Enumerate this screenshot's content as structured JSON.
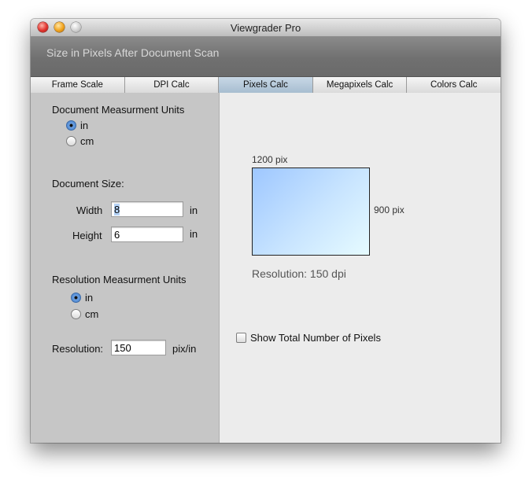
{
  "window": {
    "title": "Viewgrader Pro"
  },
  "header": {
    "subtitle": "Size in Pixels After Document Scan"
  },
  "tabs": [
    {
      "label": "Frame Scale",
      "active": false
    },
    {
      "label": "DPI Calc",
      "active": false
    },
    {
      "label": "Pixels Calc",
      "active": true
    },
    {
      "label": "Megapixels Calc",
      "active": false
    },
    {
      "label": "Colors Calc",
      "active": false
    }
  ],
  "left": {
    "doc_units": {
      "heading": "Document Measurment Units",
      "options": [
        {
          "label": "in",
          "selected": true
        },
        {
          "label": "cm",
          "selected": false
        }
      ]
    },
    "doc_size": {
      "heading": "Document Size:",
      "width_label": "Width",
      "width_value": "8",
      "width_unit": "in",
      "height_label": "Height",
      "height_value": "6",
      "height_unit": "in"
    },
    "res_units": {
      "heading": "Resolution Measurment Units",
      "options": [
        {
          "label": "in",
          "selected": true
        },
        {
          "label": "cm",
          "selected": false
        }
      ]
    },
    "resolution": {
      "label": "Resolution:",
      "value": "150",
      "unit": "pix/in"
    }
  },
  "right": {
    "width_pixels": "1200 pix",
    "height_pixels": "900 pix",
    "resolution_text": "Resolution: 150 dpi",
    "show_total_label": "Show Total Number of Pixels",
    "show_total_checked": false
  },
  "colors": {
    "active_tab": "#a7bdd0",
    "radio_selected": "#3f7cc8",
    "preview_start": "#9ec7ff",
    "preview_end": "#e6fbff"
  }
}
